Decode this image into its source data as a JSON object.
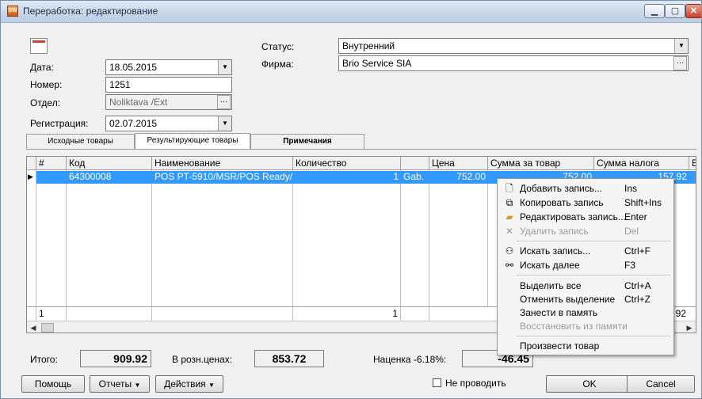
{
  "window": {
    "title": "Переработка: редактирование"
  },
  "form": {
    "date_label": "Дата:",
    "date_value": "18.05.2015",
    "number_label": "Номер:",
    "number_value": "1251",
    "dept_label": "Отдел:",
    "dept_value": "Noliktava  /Ext",
    "reg_label": "Регистрация:",
    "reg_value": "02.07.2015",
    "status_label": "Статус:",
    "status_value": "Внутренний",
    "firm_label": "Фирма:",
    "firm_value": "Brio Service SIA"
  },
  "tabs": [
    {
      "label": "Исходные товары"
    },
    {
      "label": "Результирующие товары"
    },
    {
      "label": "Примечания"
    }
  ],
  "grid": {
    "columns": [
      "#",
      "Код",
      "Наименование",
      "Количество",
      "",
      "Цена",
      "Сумма за товар",
      "Сумма налога",
      "Е"
    ],
    "row": {
      "code": "64300008",
      "name": "POS PT-5910/MSR/POS Ready/",
      "qty": "1",
      "unit": "Gab.",
      "price": "752.00",
      "sum": "752.00",
      "tax": "157.92"
    },
    "footer": {
      "count": "1",
      "qty": "1",
      "tax": "92"
    }
  },
  "context_menu": {
    "items": [
      {
        "label": "Добавить запись...",
        "shortcut": "Ins",
        "icon": "new-page-icon",
        "disabled": false
      },
      {
        "label": "Копировать запись",
        "shortcut": "Shift+Ins",
        "icon": "copy-icon",
        "disabled": false
      },
      {
        "label": "Редактировать запись...",
        "shortcut": "Enter",
        "icon": "folder-edit-icon",
        "disabled": false
      },
      {
        "label": "Удалить запись",
        "shortcut": "Del",
        "icon": "delete-x-icon",
        "disabled": true
      },
      {
        "label": "Искать запись...",
        "shortcut": "Ctrl+F",
        "icon": "binoculars-icon",
        "disabled": false
      },
      {
        "label": "Искать далее",
        "shortcut": "F3",
        "icon": "find-next-icon",
        "disabled": false
      },
      {
        "label": "Выделить все",
        "shortcut": "Ctrl+A",
        "disabled": false
      },
      {
        "label": "Отменить выделение",
        "shortcut": "Ctrl+Z",
        "disabled": false
      },
      {
        "label": "Занести в память",
        "shortcut": "",
        "disabled": false
      },
      {
        "label": "Восстановить из памяти",
        "shortcut": "",
        "disabled": true
      },
      {
        "label": "Произвести товар",
        "shortcut": "",
        "disabled": false
      }
    ]
  },
  "totals": {
    "total_label": "Итого:",
    "total_value": "909.92",
    "retail_label": "В розн.ценах:",
    "retail_value": "853.72",
    "markup_label": "Наценка -6.18%:",
    "markup_value": "-46.45"
  },
  "buttons": {
    "help": "Помощь",
    "reports": "Отчеты",
    "actions": "Действия",
    "no_post": "Не проводить",
    "ok": "OK",
    "cancel": "Cancel"
  },
  "colors": {
    "selection": "#3399ff",
    "titlebar": "#c6d6ea"
  }
}
